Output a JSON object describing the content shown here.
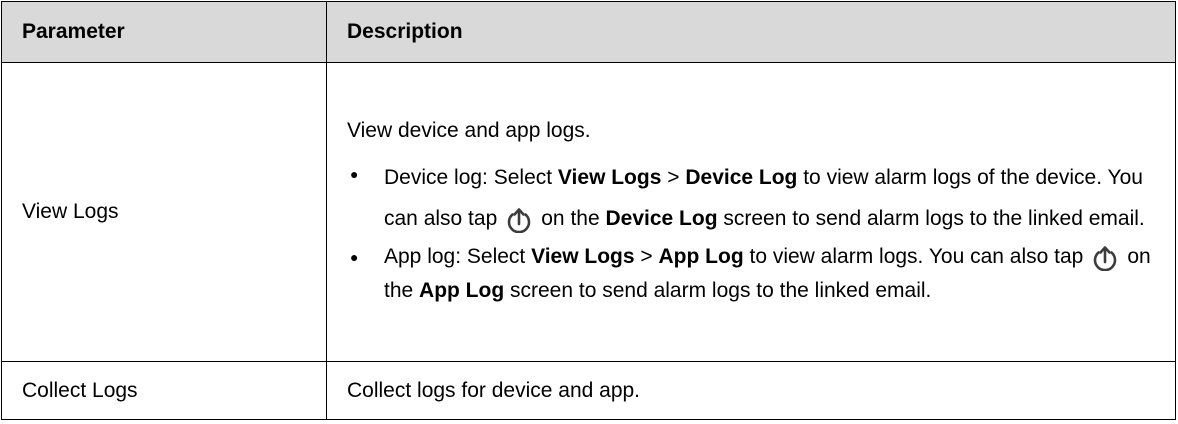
{
  "table": {
    "headers": {
      "parameter": "Parameter",
      "description": "Description"
    },
    "rows": [
      {
        "parameter": "View Logs",
        "intro": "View device and app logs.",
        "bullets": [
          {
            "t1": "Device log: Select ",
            "b1": "View Logs",
            "t2": " > ",
            "b2": "Device Log",
            "t3": " to view alarm logs of the device. You can also tap",
            "icon": "upload-icon",
            "t4": "on the ",
            "b3": "Device Log",
            "t5": " screen to send alarm logs to the linked email."
          },
          {
            "t1": "App log: Select ",
            "b1": "View Logs",
            "t2": " > ",
            "b2": "App Log",
            "t3": " to view alarm logs. You can also tap",
            "icon": "upload-icon",
            "t4": "on the ",
            "b3": "App Log",
            "t5": " screen to send alarm logs to the linked email."
          }
        ]
      },
      {
        "parameter": "Collect Logs",
        "description": "Collect logs for device and app."
      }
    ]
  }
}
